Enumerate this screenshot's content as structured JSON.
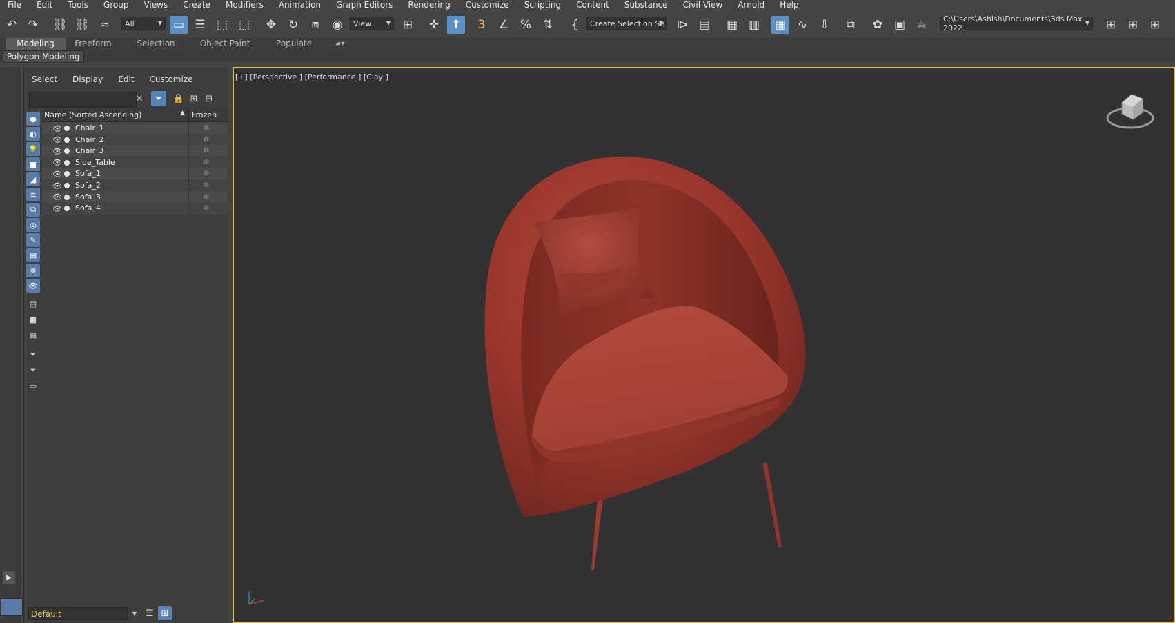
{
  "menu": [
    "File",
    "Edit",
    "Tools",
    "Group",
    "Views",
    "Create",
    "Modifiers",
    "Animation",
    "Graph Editors",
    "Rendering",
    "Customize",
    "Scripting",
    "Content",
    "Substance",
    "Civil View",
    "Arnold",
    "Help"
  ],
  "toolbar": {
    "selection_filter": "All",
    "ref_coord": "View",
    "named_selection_placeholder": "Create Selection Se",
    "project_path": "C:\\Users\\Ashish\\Documents\\3ds Max 2022"
  },
  "ribbon": {
    "tabs": [
      "Modeling",
      "Freeform",
      "Selection",
      "Object Paint",
      "Populate"
    ],
    "panel_label": "Polygon Modeling"
  },
  "explorer": {
    "menu": [
      "Select",
      "Display",
      "Edit",
      "Customize"
    ],
    "search_value": "",
    "columns": {
      "name": "Name (Sorted Ascending)",
      "frozen": "Frozen"
    },
    "rows": [
      "Chair_1",
      "Chair_2",
      "Chair_3",
      "Side_Table",
      "Sofa_1",
      "Sofa_2",
      "Sofa_3",
      "Sofa_4"
    ],
    "layer": "Default"
  },
  "viewport": {
    "label": "[+] [Perspective ] [Performance ] [Clay ]"
  },
  "colors": {
    "accent": "#5b8fc9",
    "viewport_border": "#e5b94a",
    "chair": "#b3473b"
  }
}
